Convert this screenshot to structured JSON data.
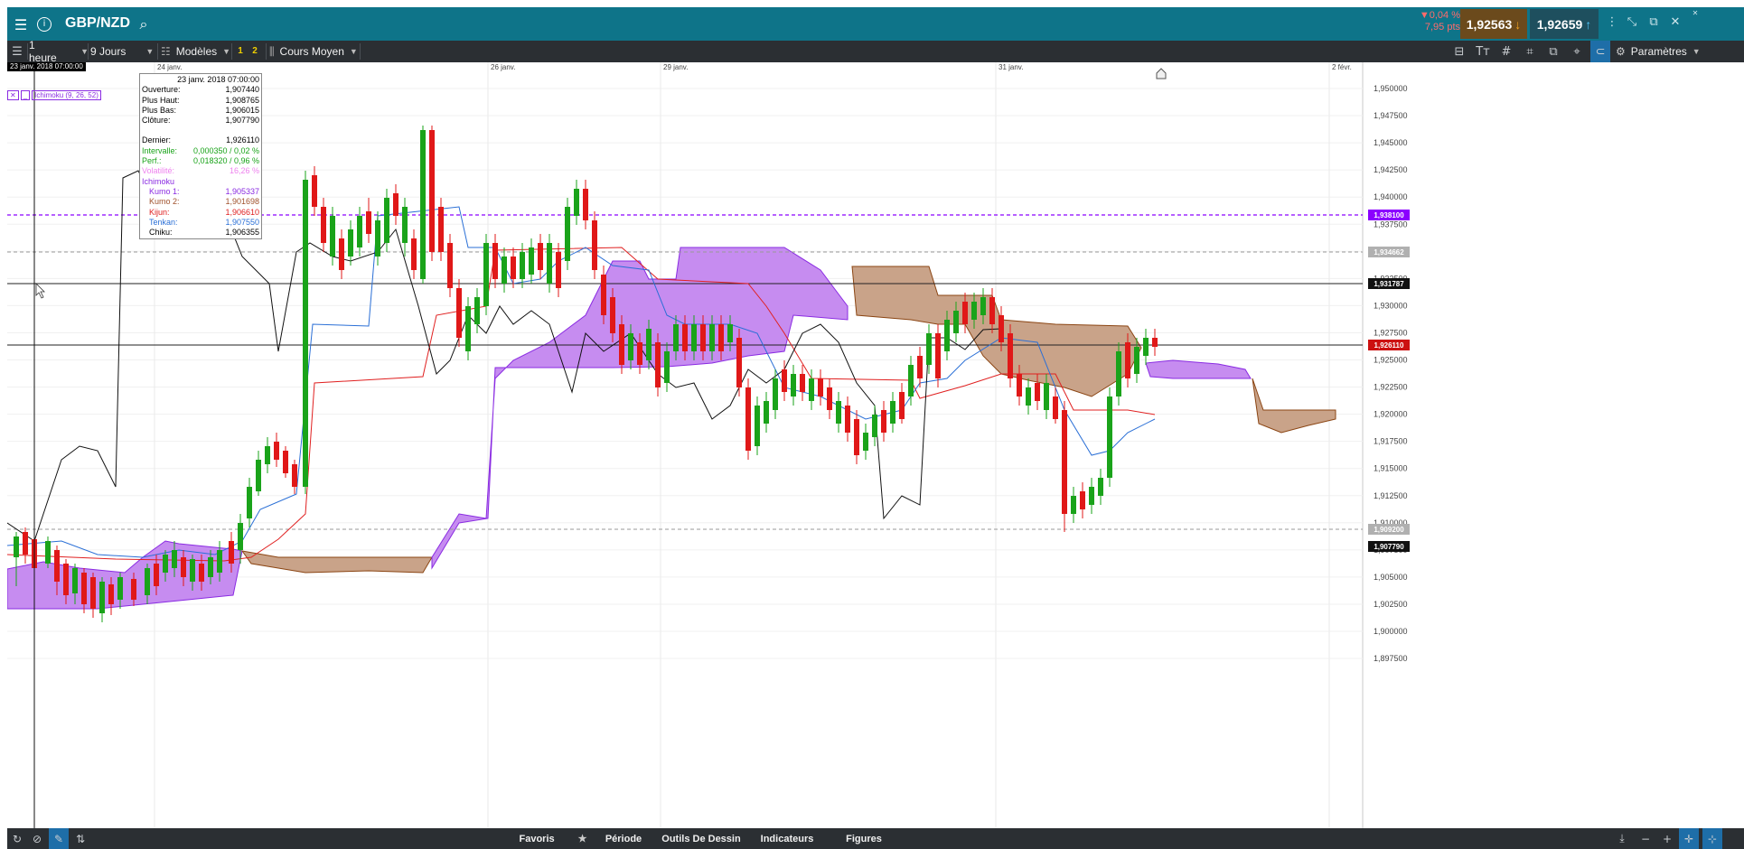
{
  "titlebar": {
    "symbol": "GBP/NZD",
    "menu_icon": "hamburger-icon",
    "info_icon": "info-icon",
    "search_icon": "search-icon",
    "change_pct": "▼0,04 %",
    "change_pts": "7,95 pts",
    "bid": "1,92563",
    "ask": "1,92659",
    "bid_color": "#6b4a1c",
    "ask_color": "#1e4f5e"
  },
  "toolbar": {
    "timeframe": "1 heure",
    "range": "9 Jours",
    "models": "Modèles",
    "badge_1": "1",
    "badge_2": "2",
    "price_type": "Cours Moyen",
    "settings": "Paramètres"
  },
  "chart": {
    "crosshair_time": "23 janv. 2018 07:00:00",
    "indicator_label": "Ichimoku (9, 26, 52)",
    "x_labels": [
      "24 janv.",
      "26 janv.",
      "29 janv.",
      "31 janv.",
      "2 févr."
    ],
    "y_labels": [
      "1,950000",
      "1,947500",
      "1,945000",
      "1,942500",
      "1,940000",
      "1,937500",
      "1,935000",
      "1,932500",
      "1,930000",
      "1,927500",
      "1,925000",
      "1,922500",
      "1,920000",
      "1,917500",
      "1,915000",
      "1,912500",
      "1,910000",
      "1,907500",
      "1,905000",
      "1,902500",
      "1,900000",
      "1,897500"
    ],
    "price_tags": [
      {
        "value": "1,938100",
        "color": "#8b00ff"
      },
      {
        "value": "1,934662",
        "color": "#b0b0b0"
      },
      {
        "value": "1,931787",
        "color": "#111111"
      },
      {
        "value": "1,926110",
        "color": "#cc1111"
      },
      {
        "value": "1,909200",
        "color": "#b0b0b0"
      },
      {
        "value": "1,907790",
        "color": "#111111"
      }
    ]
  },
  "tooltip": {
    "date": "23 janv. 2018 07:00:00",
    "open_label": "Ouverture:",
    "open": "1,907440",
    "high_label": "Plus Haut:",
    "high": "1,908765",
    "low_label": "Plus Bas:",
    "low": "1,906015",
    "close_label": "Clôture:",
    "close": "1,907790",
    "last_label": "Dernier:",
    "last": "1,926110",
    "interval_label": "Intervalle:",
    "interval": "0,000350 / 0,02 %",
    "perf_label": "Perf.:",
    "perf": "0,018320 / 0,96 %",
    "vol_label": "Volatilité:",
    "vol": "16,26 %",
    "ichimoku_label": "Ichimoku",
    "kumo1_label": "Kumo 1:",
    "kumo1": "1,905337",
    "kumo2_label": "Kumo 2:",
    "kumo2": "1,901698",
    "kijun_label": "Kijun:",
    "kijun": "1,906610",
    "tenkan_label": "Tenkan:",
    "tenkan": "1,907550",
    "chiku_label": "Chiku:",
    "chiku": "1,906355"
  },
  "bottombar": {
    "favoris": "Favoris",
    "periode": "Période",
    "outils": "Outils De Dessin",
    "indicateurs": "Indicateurs",
    "figures": "Figures"
  }
}
